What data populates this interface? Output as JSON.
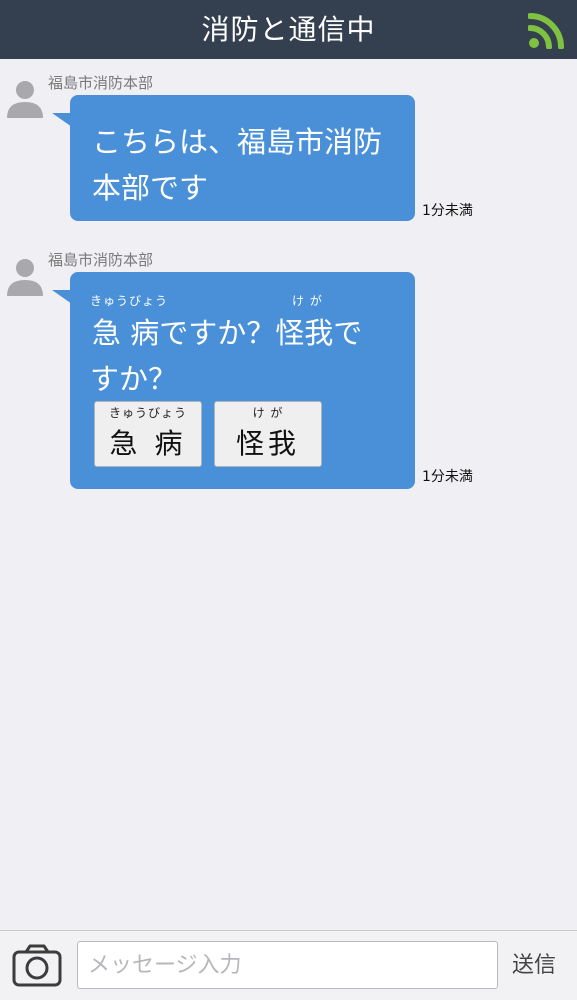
{
  "header": {
    "title": "消防と通信中",
    "status_icon": "rss-icon",
    "status_color": "#7fc241"
  },
  "messages": [
    {
      "sender": "福島市消防本部",
      "lines": [
        "こちらは、福島市消防",
        "本部です"
      ],
      "time": "1分未満"
    },
    {
      "sender": "福島市消防本部",
      "ruby_1": "きゅうびょう",
      "ruby_2": "け が",
      "lines": [
        "急 病ですか？怪我で",
        "すか？"
      ],
      "choices": [
        {
          "ruby": "きゅうびょう",
          "label": "急 病"
        },
        {
          "ruby": "け が",
          "label": "怪我"
        }
      ],
      "time": "1分未満"
    }
  ],
  "input": {
    "placeholder": "メッセージ入力",
    "value": ""
  },
  "send_label": "送信",
  "camera_icon": "camera-icon",
  "colors": {
    "header_bg": "#34404f",
    "bubble": "#4a90d9",
    "background": "#efeff4"
  }
}
